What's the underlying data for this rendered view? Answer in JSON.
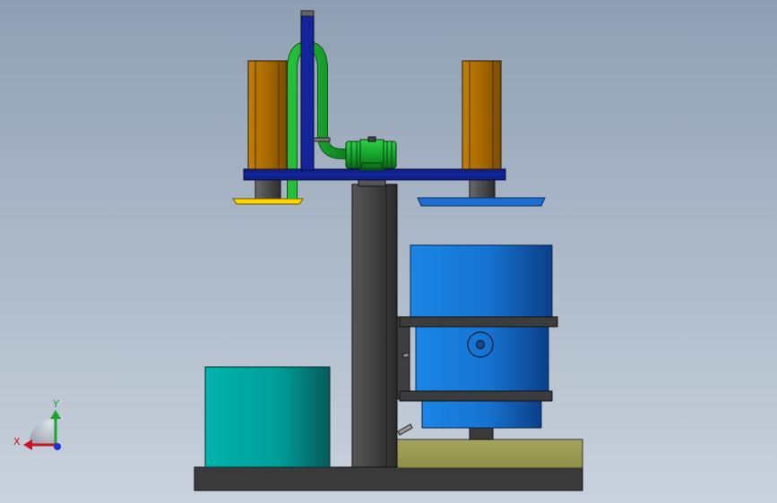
{
  "triad": {
    "x_label": "X",
    "y_label": "Y",
    "x_color": "#c8141e",
    "y_color": "#1aa52a",
    "z_color": "#1d2fd8"
  },
  "palette": {
    "steel_dark": "#3c3c3c",
    "frame_blue": "#0f1f8c",
    "pipe_green": "#1aa52a",
    "motor_green": "#17a22c",
    "box_orange": "#a56a00",
    "disc_yellow": "#ffd400",
    "disc_blue": "#1c6fd1",
    "tank_blue": "#1678d6",
    "tank_teal": "#00a5a1",
    "base_plate": "#9c9c50"
  }
}
